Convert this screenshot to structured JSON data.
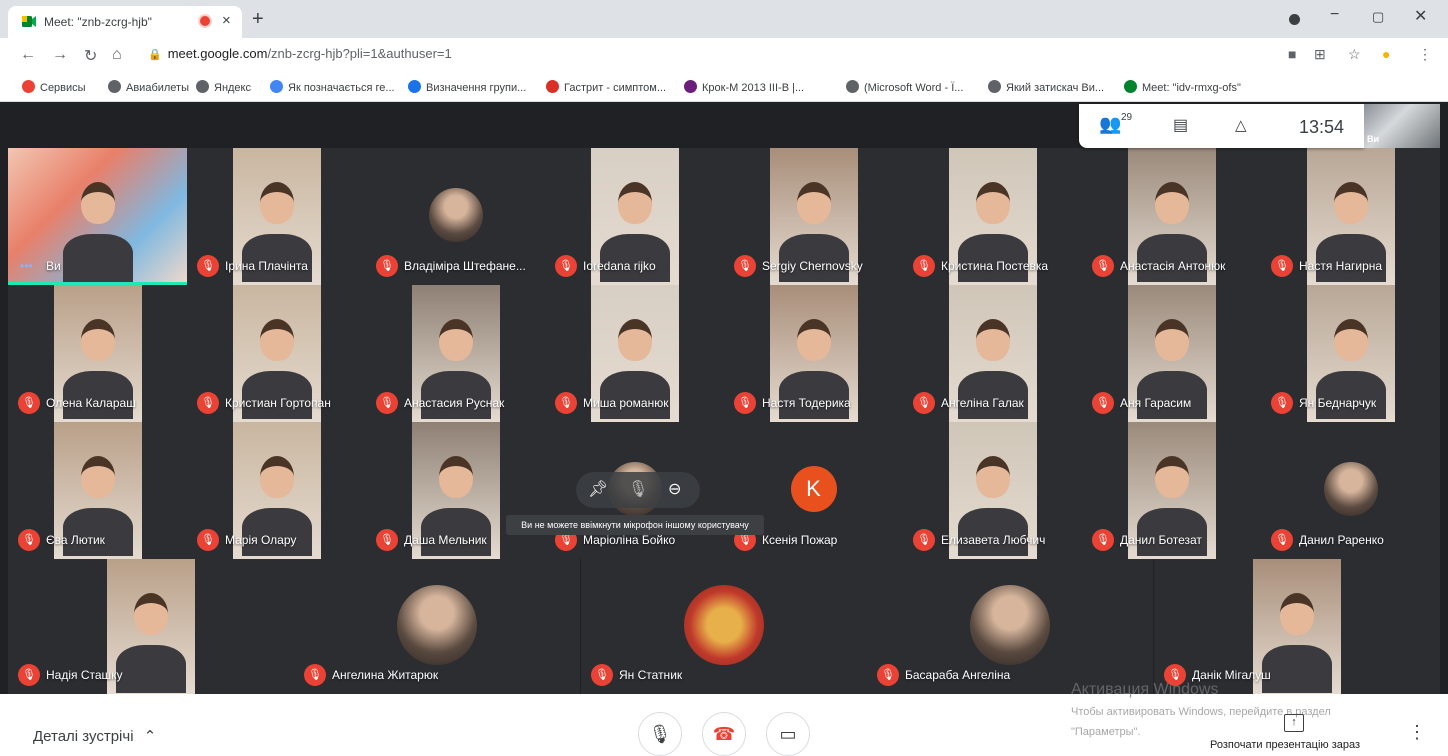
{
  "browser": {
    "tab_title": "Meet: \"znb-zcrg-hjb\"",
    "close_glyph": "×",
    "newtab_glyph": "+",
    "url_host": "meet.google.com",
    "url_path": "/znb-zcrg-hjb?pli=1&authuser=1",
    "bookmarks": [
      {
        "label": "Сервисы",
        "icon": "apps-icon",
        "color": "#ea4335"
      },
      {
        "label": "Авиабилеты",
        "icon": "globe-icon",
        "color": "#5f6368"
      },
      {
        "label": "Яндекс",
        "icon": "globe-icon",
        "color": "#5f6368"
      },
      {
        "label": "Як позначається ге...",
        "icon": "google-icon",
        "color": "#4285f4"
      },
      {
        "label": "Визначення групи...",
        "icon": "s-icon",
        "color": "#1a73e8"
      },
      {
        "label": "Гастрит - симптом...",
        "icon": "red-cross-icon",
        "color": "#d93025"
      },
      {
        "label": "Крок-М 2013 III-В |...",
        "icon": "q-icon",
        "color": "#6b1f7c"
      },
      {
        "label": "(Microsoft Word - Ї...",
        "icon": "globe-icon",
        "color": "#5f6368"
      },
      {
        "label": "Який затискач Ви...",
        "icon": "globe-icon",
        "color": "#5f6368"
      },
      {
        "label": "Meet: \"idv-rmxg-ofs\"",
        "icon": "meet-icon",
        "color": "#00832d"
      }
    ]
  },
  "meet": {
    "participants_count": "29",
    "clock": "13:54",
    "self_label": "Ви",
    "participants": [
      {
        "name": "Ви",
        "type": "video",
        "self": true
      },
      {
        "name": "Ірина Плачінта",
        "type": "video"
      },
      {
        "name": "Владіміра Штефане...",
        "type": "avatar"
      },
      {
        "name": "Ioredana rijko",
        "type": "video"
      },
      {
        "name": "Sergiy Chernovsky",
        "type": "video"
      },
      {
        "name": "Кристина Постевка",
        "type": "video"
      },
      {
        "name": "Анастасія Антонюк",
        "type": "video"
      },
      {
        "name": "Настя Нагирна",
        "type": "video"
      },
      {
        "name": "Олена Калараш",
        "type": "video"
      },
      {
        "name": "Кристиан Гортопан",
        "type": "video"
      },
      {
        "name": "Анастасия Руснак",
        "type": "video"
      },
      {
        "name": "Миша романюк",
        "type": "video"
      },
      {
        "name": "Настя Тодерика",
        "type": "video"
      },
      {
        "name": "Ангеліна Галак",
        "type": "video"
      },
      {
        "name": "Аня Гарасим",
        "type": "video"
      },
      {
        "name": "Ян Беднарчук",
        "type": "video"
      },
      {
        "name": "Єва Лютик",
        "type": "video"
      },
      {
        "name": "Марія Олару",
        "type": "video"
      },
      {
        "name": "Даша Мельник",
        "type": "video"
      },
      {
        "name": "Маріоліна Бойко",
        "type": "avatar"
      },
      {
        "name": "Ксенія Пожар",
        "type": "letter",
        "letter": "K"
      },
      {
        "name": "Елизавета Любчич",
        "type": "video"
      },
      {
        "name": "Данил Ботезат",
        "type": "video"
      },
      {
        "name": "Данил Раренко",
        "type": "avatar"
      },
      {
        "name": "Надія Сташку",
        "type": "video"
      },
      {
        "name": "Ангелина Житарюк",
        "type": "avatar"
      },
      {
        "name": "Ян Статник",
        "type": "avatar"
      },
      {
        "name": "Басараба Ангеліна",
        "type": "avatar"
      },
      {
        "name": "Данік Мігалуш",
        "type": "video"
      }
    ],
    "tooltip": "Ви не можете ввімкнути мікрофон іншому користувачу",
    "details_label": "Деталі зустрічі",
    "present_label": "Розпочати презентацію зараз",
    "windows_activation": {
      "title": "Активация Windows",
      "line1": "Чтобы активировать Windows, перейдите в раздел",
      "line2": "\"Параметры\"."
    }
  }
}
